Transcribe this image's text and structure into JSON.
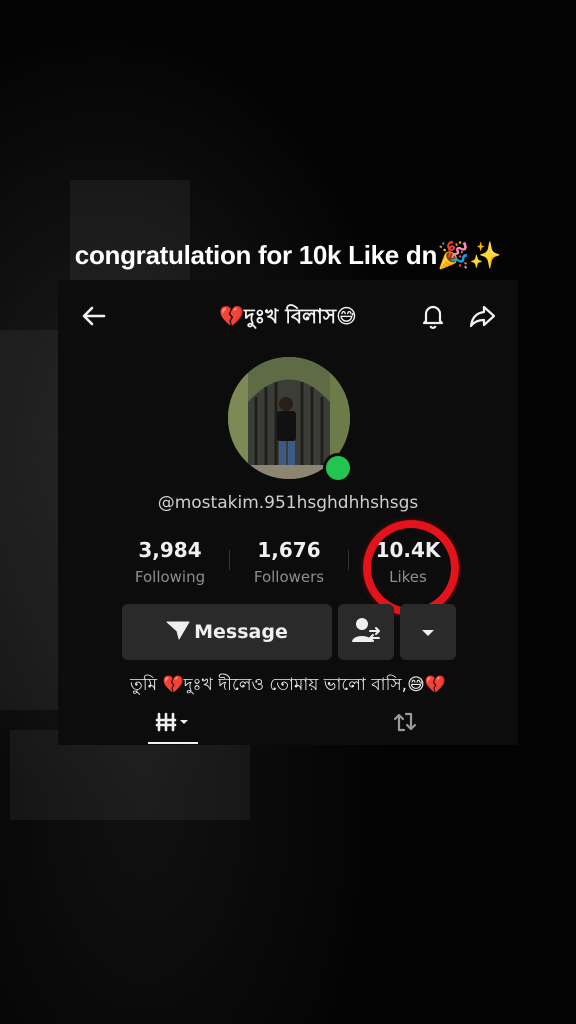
{
  "caption": "congratulation for 10k Like dn🎉✨",
  "profile": {
    "title": "💔দুঃখ বিলাস😅",
    "username": "@mostakim.951hsghdhhshsgs",
    "bio": "তুমি 💔দুঃখ দীলেও তোমায় ভালো বাসি,😅💔"
  },
  "stats": [
    {
      "value": "3,984",
      "label": "Following"
    },
    {
      "value": "1,676",
      "label": "Followers"
    },
    {
      "value": "10.4K",
      "label": "Likes"
    }
  ],
  "buttons": {
    "message_label": "Message"
  },
  "icons": {
    "back": "back-arrow-icon",
    "bell": "bell-icon",
    "share": "share-icon",
    "send": "send-icon",
    "friend": "add-friend-icon",
    "more": "chevron-down-icon",
    "grid": "grid-icon",
    "repost": "repost-icon"
  },
  "colors": {
    "background": "#000000",
    "card": "#0c0c0c",
    "button": "#2a2a2a",
    "online": "#23c552",
    "highlight_ring": "#e3121b"
  }
}
